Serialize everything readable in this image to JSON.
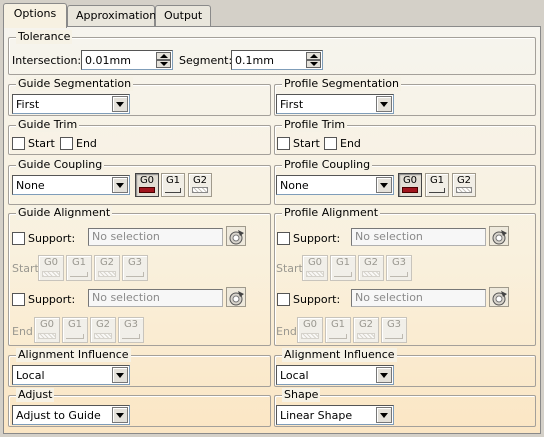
{
  "tabs": {
    "options": "Options",
    "approximation": "Approximation",
    "output": "Output"
  },
  "tolerance": {
    "title": "Tolerance",
    "intersection_label": "Intersection:",
    "intersection_value": "0.01mm",
    "segment_label": "Segment:",
    "segment_value": "0.1mm"
  },
  "guide": {
    "segmentation": {
      "title": "Guide Segmentation",
      "value": "First"
    },
    "trim": {
      "title": "Guide Trim",
      "start": "Start",
      "end": "End"
    },
    "coupling": {
      "title": "Guide Coupling",
      "value": "None",
      "g0": "G0",
      "g1": "G1",
      "g2": "G2"
    },
    "alignment": {
      "title": "Guide Alignment",
      "support_label": "Support:",
      "no_selection": "No selection",
      "start_label": "Start",
      "end_label": "End",
      "g0": "G0",
      "g1": "G1",
      "g2": "G2",
      "g3": "G3"
    },
    "influence": {
      "title": "Alignment Influence",
      "value": "Local"
    },
    "adjust": {
      "title": "Adjust",
      "value": "Adjust to Guide"
    }
  },
  "profile": {
    "segmentation": {
      "title": "Profile Segmentation",
      "value": "First"
    },
    "trim": {
      "title": "Profile Trim",
      "start": "Start",
      "end": "End"
    },
    "coupling": {
      "title": "Profile Coupling",
      "value": "None",
      "g0": "G0",
      "g1": "G1",
      "g2": "G2"
    },
    "alignment": {
      "title": "Profile Alignment",
      "support_label": "Support:",
      "no_selection": "No selection",
      "start_label": "Start",
      "end_label": "End",
      "g0": "G0",
      "g1": "G1",
      "g2": "G2",
      "g3": "G3"
    },
    "influence": {
      "title": "Alignment Influence",
      "value": "Local"
    },
    "shape": {
      "title": "Shape",
      "value": "Linear Shape"
    }
  },
  "icons": {
    "dropdown": "chevron-down-icon",
    "spinner": "spin-arrows-icon",
    "selection": "select-element-icon"
  },
  "colors": {
    "g0_swatch": "#a0141c",
    "panel_gradient_end": "#fbe6c4"
  }
}
